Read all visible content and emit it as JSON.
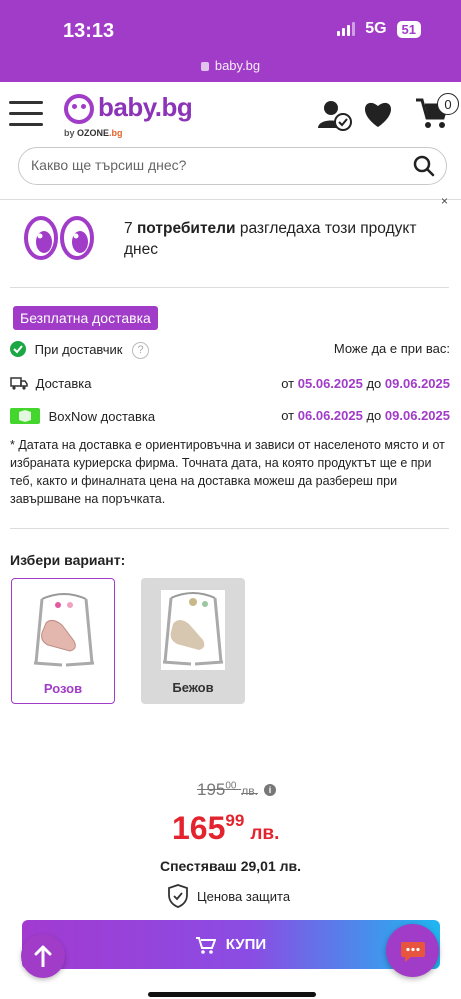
{
  "status": {
    "time": "13:13",
    "network": "5G",
    "battery": "51",
    "url": "baby.bg"
  },
  "header": {
    "logo_text": "baby.bg",
    "logo_by": "by",
    "logo_ozone": "OZONE",
    "logo_bg": ".bg",
    "cart_count": "0",
    "search_placeholder": "Какво ще търсиш днес?"
  },
  "viewers": {
    "count": "7",
    "label": "потребители",
    "text": "разгледаха този продукт днес",
    "close": "×"
  },
  "delivery": {
    "badge": "Безплатна доставка",
    "supplier_label": "При доставчик",
    "supplier_help": "?",
    "available_label": "Може да е при вас:",
    "rows": [
      {
        "label": "Доставка",
        "from": "от",
        "date_from": "05.06.2025",
        "to": "до",
        "date_to": "09.06.2025"
      },
      {
        "label": "BoxNow доставка",
        "from": "от",
        "date_from": "06.06.2025",
        "to": "до",
        "date_to": "09.06.2025"
      }
    ],
    "note": "* Датата на доставка е ориентировъчна и зависи от населеното място и от избраната куриерска фирма. Точната дата, на която продуктът ще е при теб, както и финалната цена на доставка можеш да разбереш при завършване на поръчката."
  },
  "variants": {
    "title": "Избери вариант:",
    "items": [
      {
        "label": "Розов",
        "selected": true
      },
      {
        "label": "Бежов",
        "selected": false
      }
    ]
  },
  "pricing": {
    "old_int": "195",
    "old_dec": "00",
    "old_cur": "лв.",
    "info": "i",
    "price_int": "165",
    "price_dec": "99",
    "price_cur": "лв.",
    "savings": "Спестяваш 29,01 лв.",
    "protection": "Ценова защита"
  },
  "buy": {
    "label": "КУПИ"
  },
  "colors": {
    "brand": "#a03cc8",
    "price": "#e3232d",
    "success": "#1aa845"
  }
}
